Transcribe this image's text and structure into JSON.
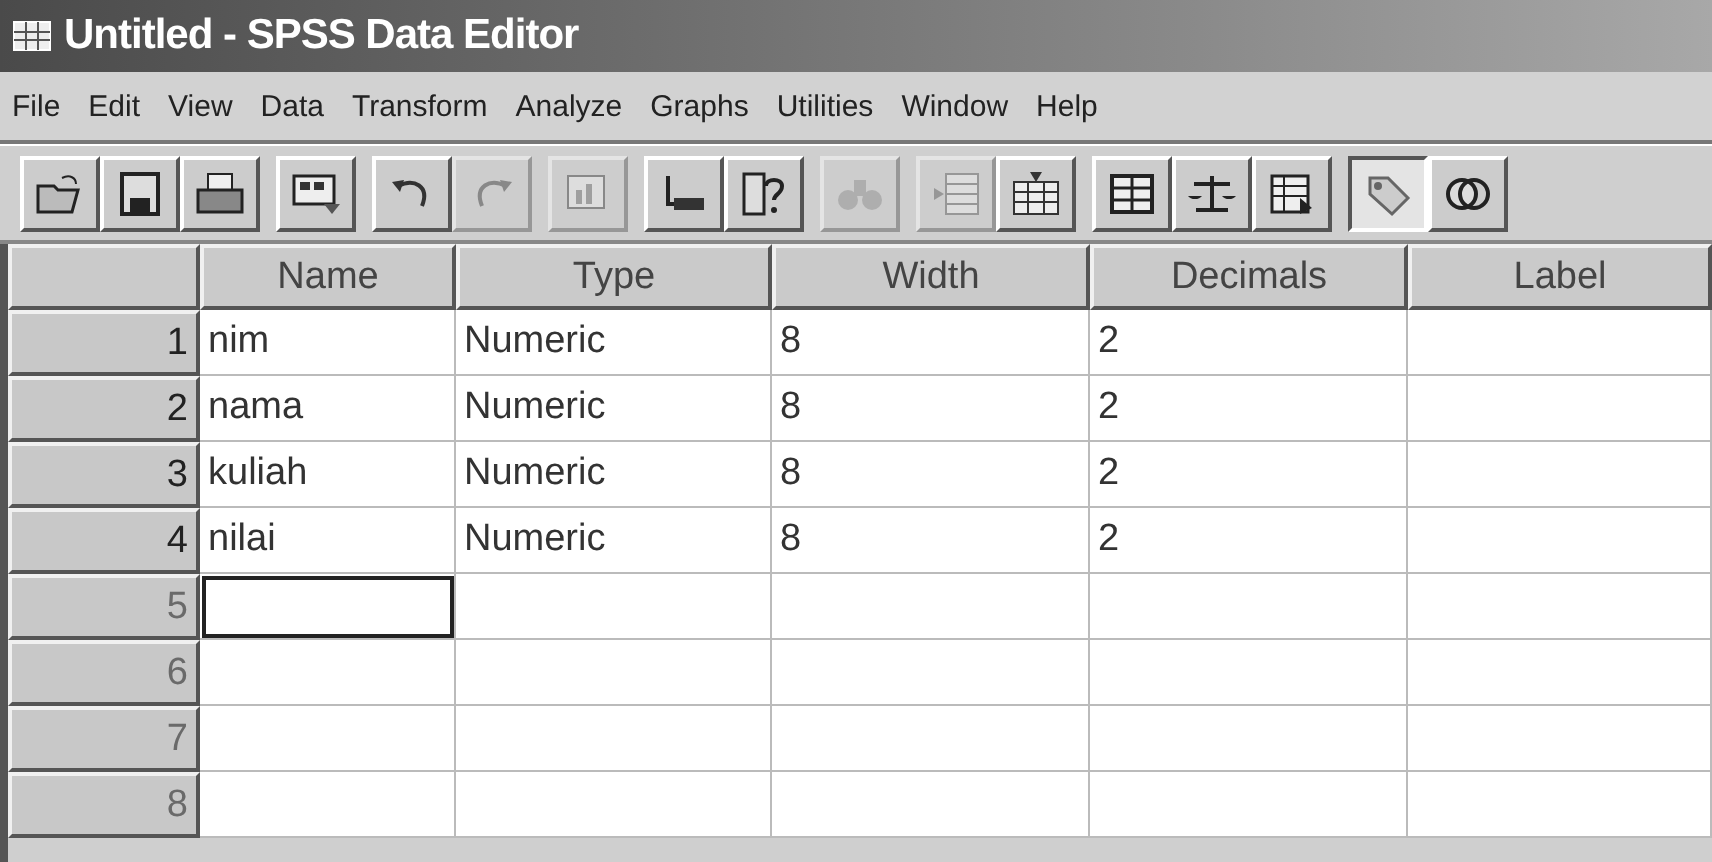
{
  "window": {
    "title": "Untitled - SPSS Data Editor"
  },
  "menu": [
    "File",
    "Edit",
    "View",
    "Data",
    "Transform",
    "Analyze",
    "Graphs",
    "Utilities",
    "Window",
    "Help"
  ],
  "toolbar": [
    [
      {
        "disabled": false,
        "pressed": false
      },
      {
        "disabled": false,
        "pressed": false
      },
      {
        "disabled": false,
        "pressed": false
      }
    ],
    [
      {
        "disabled": false,
        "pressed": false
      }
    ],
    [
      {
        "disabled": false,
        "pressed": false
      },
      {
        "disabled": true,
        "pressed": false
      }
    ],
    [
      {
        "disabled": true,
        "pressed": false
      }
    ],
    [
      {
        "disabled": false,
        "pressed": false
      },
      {
        "disabled": false,
        "pressed": false
      }
    ],
    [
      {
        "disabled": true,
        "pressed": false
      }
    ],
    [
      {
        "disabled": true,
        "pressed": false
      },
      {
        "disabled": false,
        "pressed": false
      }
    ],
    [
      {
        "disabled": false,
        "pressed": false
      },
      {
        "disabled": false,
        "pressed": false
      },
      {
        "disabled": false,
        "pressed": false
      }
    ],
    [
      {
        "disabled": false,
        "pressed": true
      },
      {
        "disabled": false,
        "pressed": false
      }
    ]
  ],
  "table": {
    "columns": [
      "Name",
      "Type",
      "Width",
      "Decimals",
      "Label"
    ],
    "rows": [
      {
        "number": "1",
        "disabled": false,
        "cells": [
          {
            "value": "nim",
            "selected": false
          },
          {
            "value": "Numeric",
            "selected": false
          },
          {
            "value": "8",
            "selected": false
          },
          {
            "value": "2",
            "selected": false
          },
          {
            "selected": false
          }
        ]
      },
      {
        "number": "2",
        "disabled": false,
        "cells": [
          {
            "value": "nama",
            "selected": false
          },
          {
            "value": "Numeric",
            "selected": false
          },
          {
            "value": "8",
            "selected": false
          },
          {
            "value": "2",
            "selected": false
          },
          {
            "selected": false
          }
        ]
      },
      {
        "number": "3",
        "disabled": false,
        "cells": [
          {
            "value": "kuliah",
            "selected": false
          },
          {
            "value": "Numeric",
            "selected": false
          },
          {
            "value": "8",
            "selected": false
          },
          {
            "value": "2",
            "selected": false
          },
          {
            "selected": false
          }
        ]
      },
      {
        "number": "4",
        "disabled": false,
        "cells": [
          {
            "value": "nilai",
            "selected": false
          },
          {
            "value": "Numeric",
            "selected": false
          },
          {
            "value": "8",
            "selected": false
          },
          {
            "value": "2",
            "selected": false
          },
          {
            "selected": false
          }
        ]
      },
      {
        "number": "5",
        "disabled": true,
        "cells": [
          {
            "selected": true
          },
          {
            "selected": false
          },
          {
            "selected": false
          },
          {
            "selected": false
          },
          {
            "selected": false
          }
        ]
      },
      {
        "number": "6",
        "disabled": true,
        "cells": [
          {
            "selected": false
          },
          {
            "selected": false
          },
          {
            "selected": false
          },
          {
            "selected": false
          },
          {
            "selected": false
          }
        ]
      },
      {
        "number": "7",
        "disabled": true,
        "cells": [
          {
            "selected": false
          },
          {
            "selected": false
          },
          {
            "selected": false
          },
          {
            "selected": false
          },
          {
            "selected": false
          }
        ]
      },
      {
        "number": "8",
        "disabled": true,
        "cells": [
          {
            "selected": false
          },
          {
            "selected": false
          },
          {
            "selected": false
          },
          {
            "selected": false
          },
          {
            "selected": false
          }
        ]
      }
    ]
  }
}
